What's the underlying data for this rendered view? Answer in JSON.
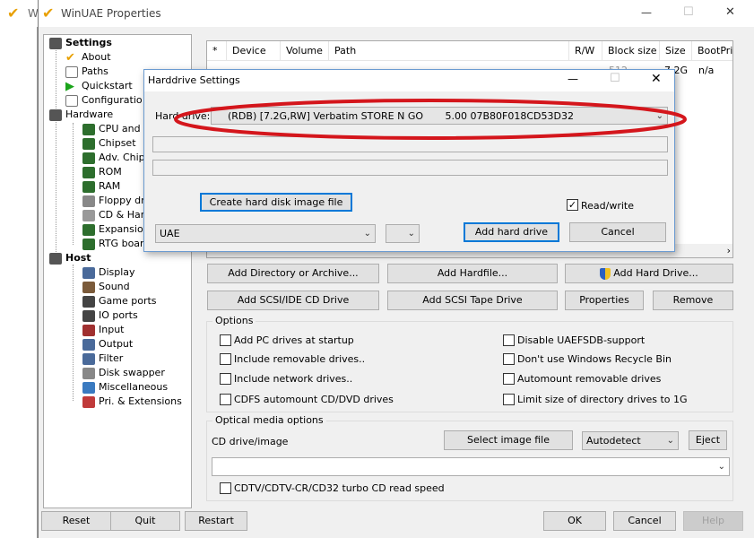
{
  "main_window": {
    "title": "WinUAE Properties",
    "controls": {
      "minimize": "—",
      "maximize": "☐",
      "close": "✕"
    }
  },
  "bg_window": {
    "title": "W"
  },
  "tree": {
    "settings": "Settings",
    "about": "About",
    "paths": "Paths",
    "quickstart": "Quickstart",
    "configurations": "Configuratio",
    "hardware": "Hardware",
    "cpu": "CPU and",
    "chipset": "Chipset",
    "adv_chipset": "Adv. Chip",
    "rom": "ROM",
    "ram": "RAM",
    "floppy": "Floppy dr",
    "cd_hard": "CD & Har",
    "expansions": "Expansio",
    "rtg": "RTG boar",
    "host": "Host",
    "display": "Display",
    "sound": "Sound",
    "game_ports": "Game ports",
    "io_ports": "IO ports",
    "input": "Input",
    "output": "Output",
    "filter": "Filter",
    "disk_swapper": "Disk swapper",
    "misc": "Miscellaneous",
    "pri_ext": "Pri. & Extensions"
  },
  "table": {
    "headers": [
      "*",
      "Device",
      "Volume",
      "Path",
      "R/W",
      "Block size",
      "Size",
      "BootPri"
    ],
    "row": {
      "size": "7.2G",
      "bootpri": "n/a",
      "rw": "512"
    }
  },
  "hd_buttons": {
    "add_dir": "Add Directory or Archive...",
    "add_hardfile": "Add Hardfile...",
    "add_hard_drive": "Add Hard Drive...",
    "add_scsi_cd": "Add SCSI/IDE CD Drive",
    "add_scsi_tape": "Add SCSI Tape Drive",
    "properties": "Properties",
    "remove": "Remove"
  },
  "options": {
    "title": "Options",
    "items": {
      "add_pc_drives": "Add PC drives at startup",
      "include_removable": "Include removable drives..",
      "include_network": "Include network drives..",
      "cdfs_automount": "CDFS automount CD/DVD drives",
      "disable_uaefsdb": "Disable UAEFSDB-support",
      "no_recycle_bin": "Don't use Windows Recycle Bin",
      "automount_removable": "Automount removable drives",
      "limit_size": "Limit size of directory drives to 1G"
    }
  },
  "optical": {
    "title": "Optical media options",
    "cd_drive_label": "CD drive/image",
    "select_image": "Select image file",
    "autodetect": "Autodetect",
    "eject": "Eject",
    "cdtv_turbo": "CDTV/CDTV-CR/CD32 turbo CD read speed"
  },
  "bottom": {
    "reset": "Reset",
    "quit": "Quit",
    "restart": "Restart",
    "ok": "OK",
    "cancel": "Cancel",
    "help": "Help"
  },
  "dialog": {
    "title": "Harddrive Settings",
    "hard_drive_label": "Hard drive:",
    "hard_drive_value": "(RDB) [7.2G,RW] Verbatim STORE N GO       5.00 07B80F018CD53D32",
    "create_image": "Create hard disk image file",
    "read_write": "Read/write",
    "read_write_checked": true,
    "controller": "UAE",
    "add_hard_drive": "Add hard drive",
    "cancel": "Cancel"
  },
  "colors": {
    "annotation_red": "#d4161c",
    "focus_blue": "#0078d7",
    "button_gray": "#e1e1e1"
  }
}
